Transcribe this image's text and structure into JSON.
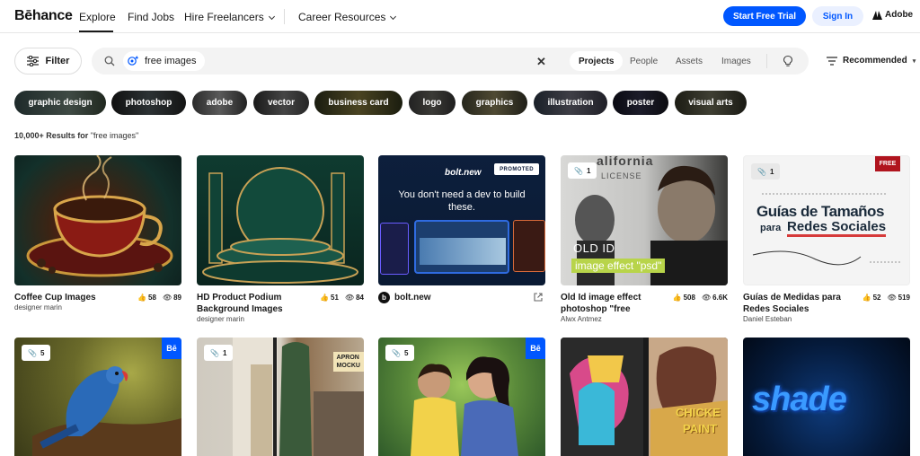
{
  "header": {
    "logo": "Bēhance",
    "nav": {
      "explore": "Explore",
      "find_jobs": "Find Jobs",
      "hire": "Hire Freelancers",
      "career": "Career Resources"
    },
    "start_trial": "Start Free Trial",
    "sign_in": "Sign In",
    "adobe": "Adobe"
  },
  "toolbar": {
    "filter_label": "Filter",
    "search_query": "free images",
    "tabs": [
      "Projects",
      "People",
      "Assets",
      "Images"
    ],
    "active_tab": "Projects",
    "sort_label": "Recommended"
  },
  "tags": [
    "graphic design",
    "photoshop",
    "adobe",
    "vector",
    "business card",
    "logo",
    "graphics",
    "illustration",
    "poster",
    "visual arts"
  ],
  "results": {
    "count": "10,000+ Results for",
    "query": "\"free images\""
  },
  "cards": [
    {
      "title": "Coffee Cup Images",
      "owner": "designer marin",
      "likes": "58",
      "views": "89"
    },
    {
      "title": "HD Product Podium Background Images",
      "owner": "designer marin",
      "likes": "51",
      "views": "84"
    },
    {
      "title": "bolt.new",
      "promoted": "PROMOTED",
      "headline": "You don't need a dev to build these.",
      "brand": "bolt.new"
    },
    {
      "title": "Old Id image effect photoshop \"free",
      "owner": "Alwx Antmez",
      "likes": "508",
      "views": "6.6K",
      "count": "1",
      "overlay_top": "OLD ID",
      "overlay_bottom": "image effect \"psd\"",
      "bg_text_1": "alifornia",
      "bg_text_2": "LICENSE"
    },
    {
      "title": "Guías de Medidas para Redes Sociales",
      "owner": "Daniel Esteban",
      "likes": "52",
      "views": "519",
      "count": "1",
      "free": "FREE",
      "heading_1": "Guías de Tamaños",
      "heading_2": "para",
      "heading_3": "Redes Sociales"
    },
    {
      "count": "5",
      "be": "Bē"
    },
    {
      "count": "1",
      "mock_label_1": "APRON",
      "mock_label_2": "MOCKU"
    },
    {
      "count": "5",
      "be": "Bē"
    },
    {
      "art_text_1": "CHICKE",
      "art_text_2": "PAINT"
    },
    {
      "art_text": "shade"
    }
  ],
  "colors": {
    "primary": "#0057ff",
    "signin_bg": "#eaf0ff",
    "free_badge": "#b0141e"
  }
}
